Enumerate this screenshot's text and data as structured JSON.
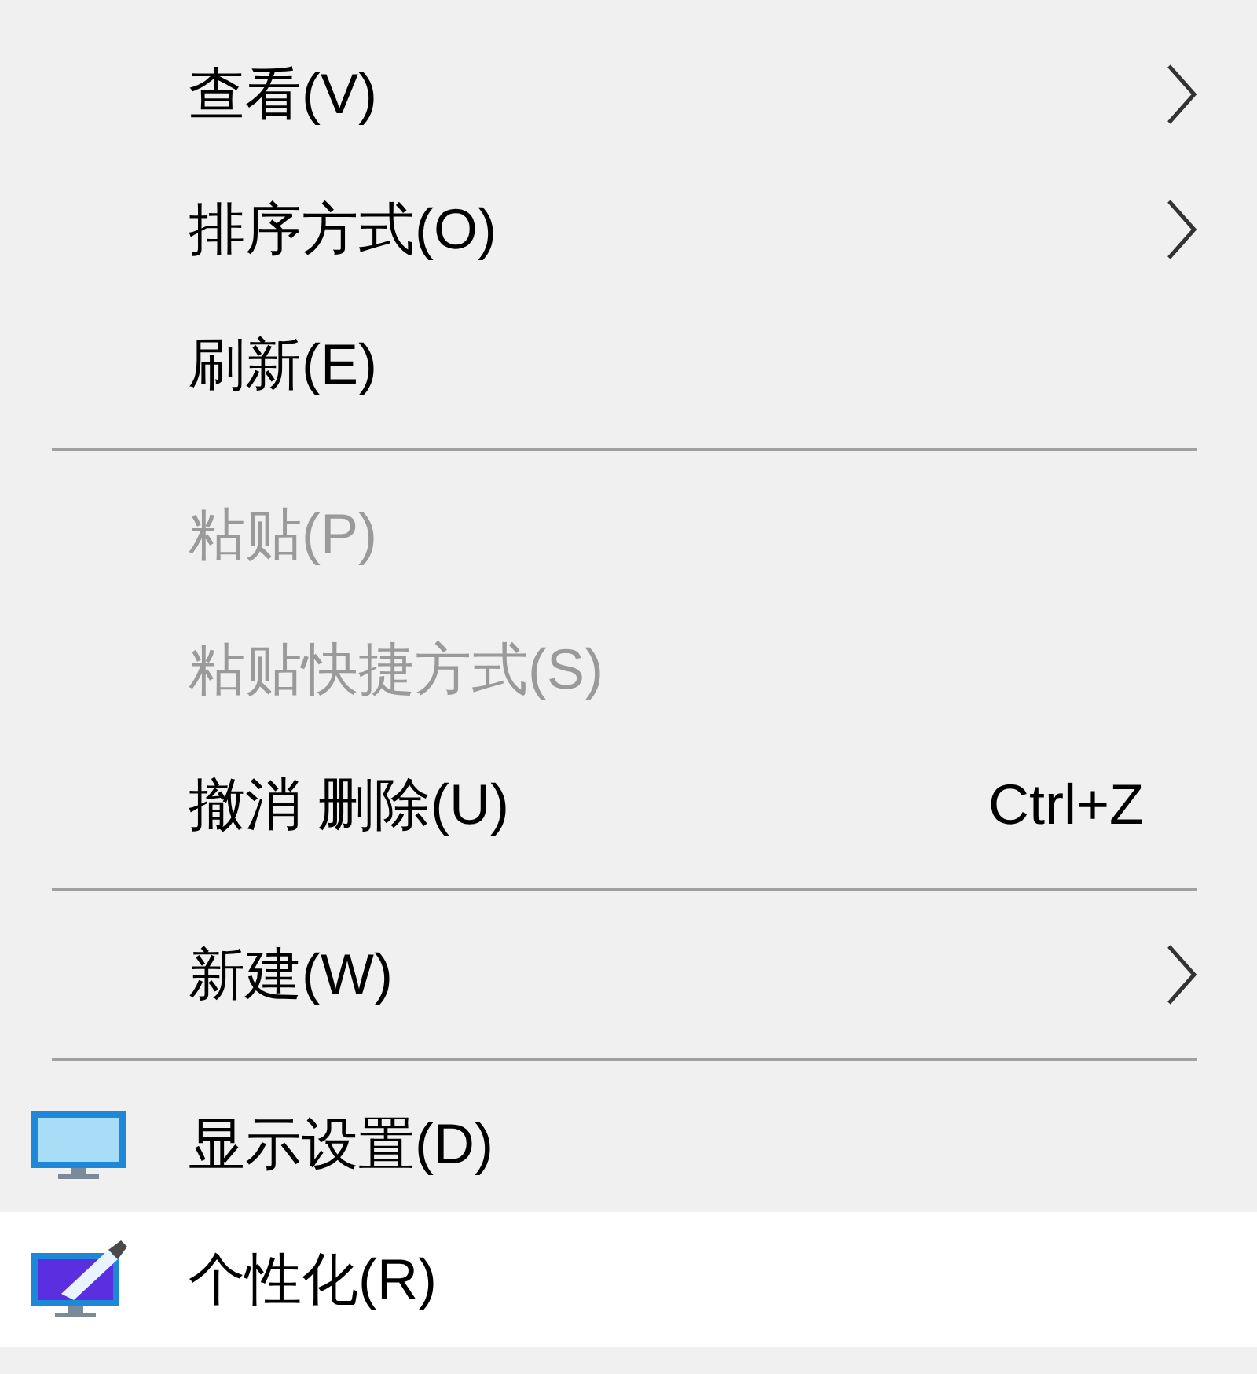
{
  "menu": {
    "items": [
      {
        "kind": "submenu",
        "label": "查看(V)",
        "disabled": false,
        "selected": false
      },
      {
        "kind": "submenu",
        "label": "排序方式(O)",
        "disabled": false,
        "selected": false
      },
      {
        "kind": "command",
        "label": "刷新(E)",
        "disabled": false,
        "selected": false
      },
      {
        "kind": "separator"
      },
      {
        "kind": "command",
        "label": "粘贴(P)",
        "disabled": true,
        "selected": false
      },
      {
        "kind": "command",
        "label": "粘贴快捷方式(S)",
        "disabled": true,
        "selected": false
      },
      {
        "kind": "command",
        "label": "撤消 删除(U)",
        "shortcut": "Ctrl+Z",
        "disabled": false,
        "selected": false
      },
      {
        "kind": "separator"
      },
      {
        "kind": "submenu",
        "label": "新建(W)",
        "disabled": false,
        "selected": false
      },
      {
        "kind": "separator"
      },
      {
        "kind": "display",
        "label": "显示设置(D)",
        "disabled": false,
        "selected": false
      },
      {
        "kind": "personalize",
        "label": "个性化(R)",
        "disabled": false,
        "selected": true
      }
    ]
  }
}
